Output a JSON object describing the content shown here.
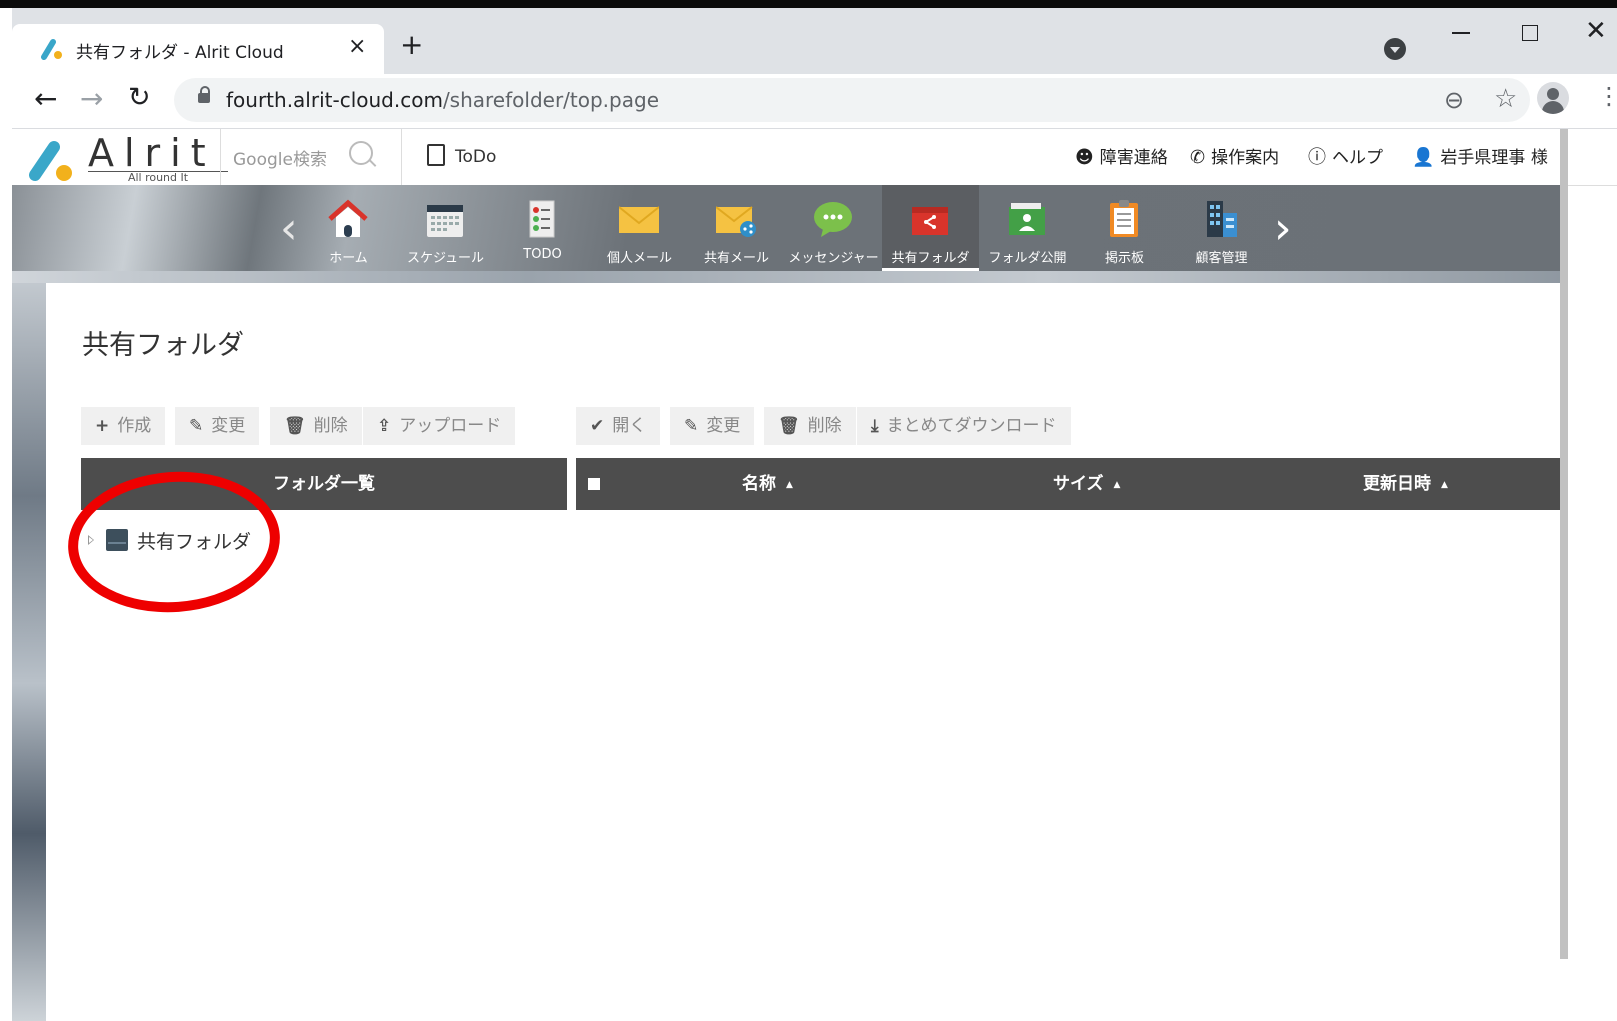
{
  "browser": {
    "tab_title": "共有フォルダ - Alrit Cloud",
    "tab_close": "×",
    "new_tab": "+",
    "url_host": "fourth.alrit-cloud.com",
    "url_path": "/sharefolder/top.page"
  },
  "header": {
    "logo_text": "Alrit",
    "logo_sub": "All round It",
    "google_search_placeholder": "Google検索",
    "todo_label": "ToDo",
    "links": [
      {
        "label": "障害連絡",
        "icon": "support-agent-icon"
      },
      {
        "label": "操作案内",
        "icon": "phone-icon"
      },
      {
        "label": "ヘルプ",
        "icon": "help-icon"
      },
      {
        "label": "岩手県理事 様",
        "icon": "user-icon"
      }
    ]
  },
  "nav": {
    "items": [
      {
        "label": "ホーム",
        "icon": "home-icon"
      },
      {
        "label": "スケジュール",
        "icon": "calendar-icon"
      },
      {
        "label": "TODO",
        "icon": "checklist-icon"
      },
      {
        "label": "個人メール",
        "icon": "mail-icon"
      },
      {
        "label": "共有メール",
        "icon": "shared-mail-icon"
      },
      {
        "label": "メッセンジャー",
        "icon": "chat-bubble-icon"
      },
      {
        "label": "共有フォルダ",
        "icon": "shared-folder-icon",
        "active": true
      },
      {
        "label": "フォルダ公開",
        "icon": "public-folder-icon"
      },
      {
        "label": "掲示板",
        "icon": "clipboard-icon"
      },
      {
        "label": "顧客管理",
        "icon": "building-icon"
      }
    ]
  },
  "main": {
    "title": "共有フォルダ",
    "left_toolbar": [
      {
        "icon": "+",
        "label": "作成"
      },
      {
        "icon": "✎",
        "label": "変更"
      },
      {
        "icon": "🗑",
        "label": "削除"
      },
      {
        "icon": "⇪",
        "label": "アップロード"
      }
    ],
    "right_toolbar": [
      {
        "icon": "✔",
        "label": "開く"
      },
      {
        "icon": "✎",
        "label": "変更"
      },
      {
        "icon": "🗑",
        "label": "削除"
      },
      {
        "icon": "⤓",
        "label": "まとめてダウンロード"
      }
    ],
    "folder_list_header": "フォルダ一覧",
    "columns": [
      "名称",
      "サイズ",
      "更新日時"
    ],
    "sort_arrow": "▲",
    "tree": [
      {
        "label": "共有フォルダ"
      }
    ]
  },
  "colors": {
    "annotation": "#ee0000",
    "active_nav": "#5b5e62",
    "table_header": "#4d4d4d"
  }
}
